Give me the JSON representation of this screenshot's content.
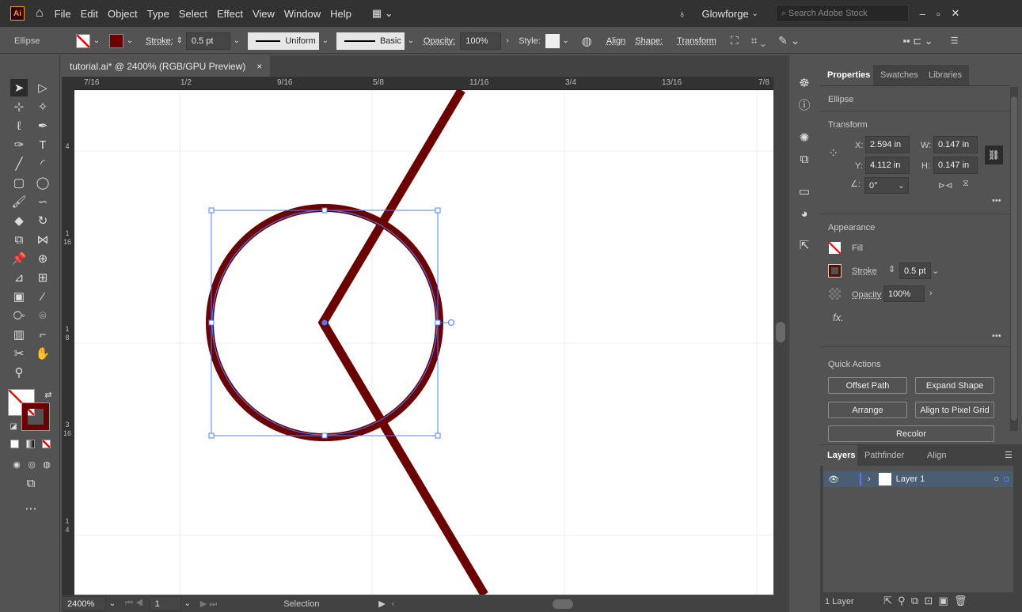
{
  "app": {
    "logo": "Ai",
    "menu": [
      "File",
      "Edit",
      "Object",
      "Type",
      "Select",
      "Effect",
      "View",
      "Window",
      "Help"
    ],
    "workspace": "Glowforge",
    "search_placeholder": "Search Adobe Stock"
  },
  "control": {
    "object_type": "Ellipse",
    "stroke_label": "Stroke:",
    "stroke_value": "0.5 pt",
    "profile": "Uniform",
    "brush": "Basic",
    "opacity_label": "Opacity:",
    "opacity_value": "100%",
    "style_label": "Style:",
    "align": "Align",
    "shape": "Shape:",
    "transform": "Transform"
  },
  "document": {
    "tab_title": "tutorial.ai* @ 2400% (RGB/GPU Preview)",
    "close": "×"
  },
  "ruler": {
    "top": [
      "7/16",
      "1/2",
      "9/16",
      "5/8",
      "11/16",
      "3/4",
      "13/16",
      "7/8"
    ],
    "left": [
      [
        "4"
      ],
      [
        "1",
        "16"
      ],
      [
        "1",
        "8"
      ],
      [
        "3",
        "16"
      ],
      [
        "1",
        "4"
      ]
    ]
  },
  "status": {
    "zoom": "2400%",
    "artboard": "1",
    "tool": "Selection"
  },
  "art": {
    "stroke_color": "#6b0000",
    "selection_color": "#4f7cff"
  },
  "panel": {
    "tabs": [
      "Properties",
      "Swatches",
      "Libraries"
    ],
    "object": "Ellipse",
    "transform": {
      "title": "Transform",
      "x_label": "X:",
      "x": "2.594 in",
      "y_label": "Y:",
      "y": "4.112 in",
      "w_label": "W:",
      "w": "0.147 in",
      "h_label": "H:",
      "h": "0.147 in",
      "angle": "0°"
    },
    "appearance": {
      "title": "Appearance",
      "fill": "Fill",
      "stroke": "Stroke",
      "stroke_value": "0.5 pt",
      "opacity": "Opacity",
      "opacity_value": "100%",
      "fx": "fx."
    },
    "quick_actions": {
      "title": "Quick Actions",
      "buttons": [
        "Offset Path",
        "Expand Shape",
        "Arrange",
        "Align to Pixel Grid",
        "Recolor"
      ]
    },
    "layers": {
      "tabs": [
        "Layers",
        "Pathfinder",
        "Align"
      ],
      "items": [
        {
          "name": "Layer 1"
        }
      ],
      "count": "1 Layer"
    }
  }
}
